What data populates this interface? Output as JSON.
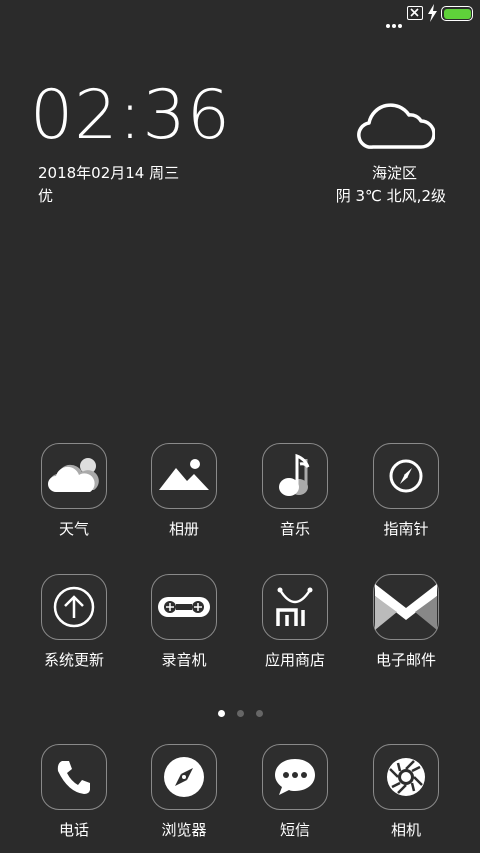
{
  "status_bar": {
    "more_icon": "more-dots-icon",
    "sim_icon": "no-sim-icon",
    "charging_icon": "bolt-icon",
    "battery_icon": "battery-icon",
    "battery_level": 1.0,
    "battery_color": "#5fd13a"
  },
  "clock_widget": {
    "time": "02:36",
    "date": "2018年02月14 周三",
    "air_quality": "优"
  },
  "weather_widget": {
    "icon": "cloud-icon",
    "location": "海淀区",
    "description": "阴 3℃ 北风,2级"
  },
  "apps": [
    {
      "label": "天气",
      "icon": "weather-icon"
    },
    {
      "label": "相册",
      "icon": "gallery-icon"
    },
    {
      "label": "音乐",
      "icon": "music-icon"
    },
    {
      "label": "指南针",
      "icon": "compass-icon"
    },
    {
      "label": "系统更新",
      "icon": "update-icon"
    },
    {
      "label": "录音机",
      "icon": "recorder-icon"
    },
    {
      "label": "应用商店",
      "icon": "app-store-icon"
    },
    {
      "label": "电子邮件",
      "icon": "email-icon"
    }
  ],
  "pager": {
    "pages": 3,
    "current": 1
  },
  "dock": [
    {
      "label": "电话",
      "icon": "phone-icon"
    },
    {
      "label": "浏览器",
      "icon": "browser-icon"
    },
    {
      "label": "短信",
      "icon": "messages-icon"
    },
    {
      "label": "相机",
      "icon": "camera-icon"
    }
  ]
}
